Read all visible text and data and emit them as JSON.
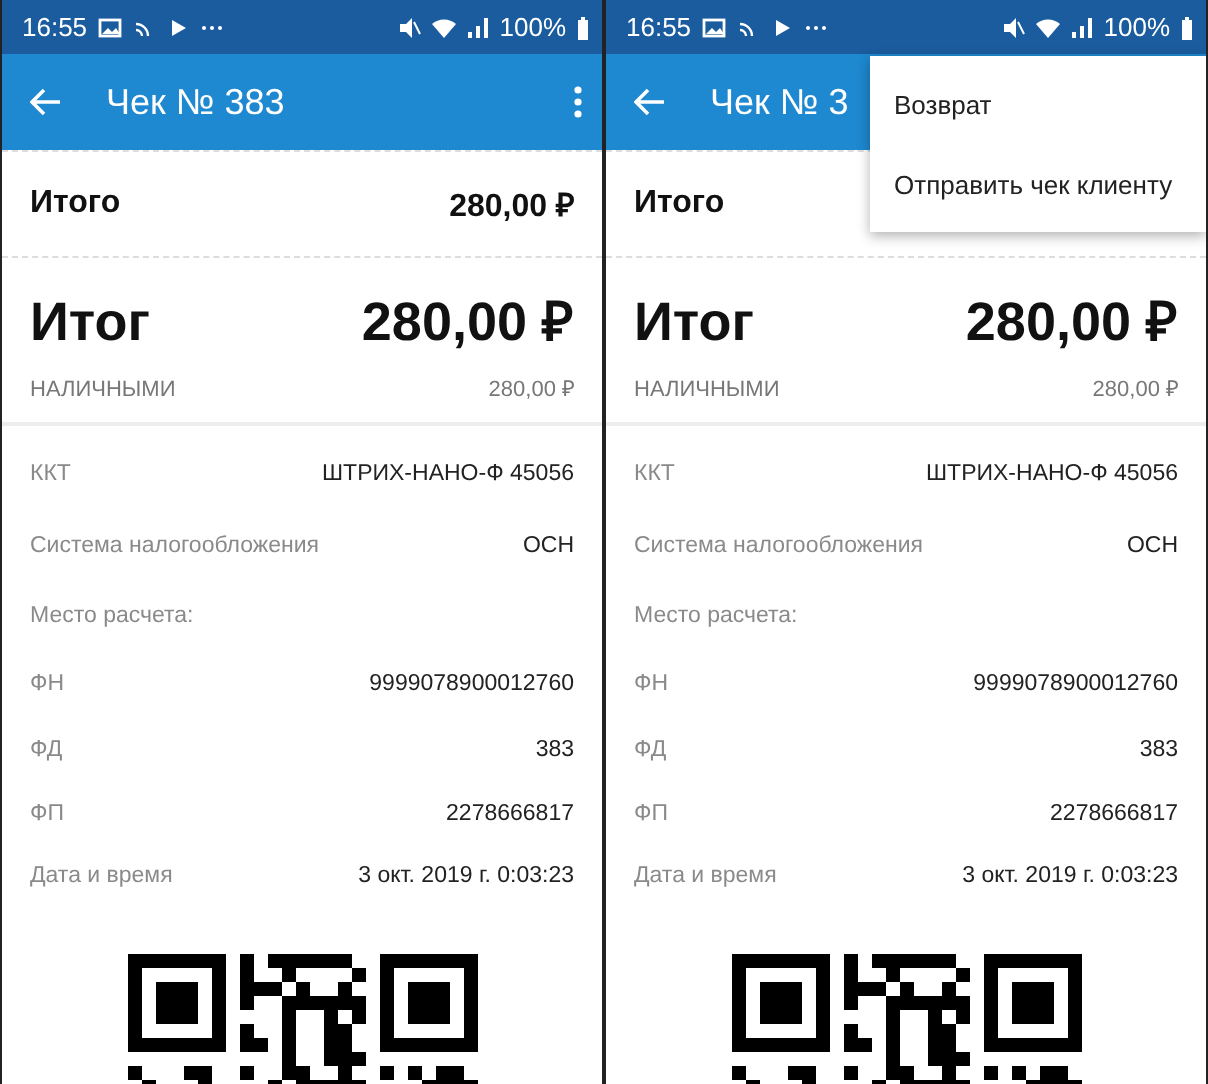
{
  "screens": [
    {
      "status": {
        "time": "16:55",
        "battery": "100%"
      },
      "title": "Чек № 383",
      "menu_button": true,
      "total_row": {
        "label": "Итого",
        "value": "280,00 ₽"
      },
      "grand_total": {
        "label": "Итог",
        "value": "280,00 ₽"
      },
      "payment": {
        "label": "НАЛИЧНЫМИ",
        "value": "280,00 ₽"
      },
      "details": [
        {
          "label": "ККТ",
          "value": "ШТРИХ-НАНО-Ф 45056"
        },
        {
          "label": "Система налогообложения",
          "value": "ОСН"
        },
        {
          "label": "Место расчета:"
        },
        {
          "label": "ФН",
          "value": "9999078900012760"
        },
        {
          "label": "ФД",
          "value": "383"
        },
        {
          "label": "ФП",
          "value": "2278666817"
        },
        {
          "label": "Дата и время",
          "value": "3 окт. 2019 г. 0:03:23"
        }
      ]
    },
    {
      "status": {
        "time": "16:55",
        "battery": "100%"
      },
      "title": "Чек № 3",
      "menu_button": false,
      "total_row": {
        "label": "Итого"
      },
      "grand_total": {
        "label": "Итог",
        "value": "280,00 ₽"
      },
      "payment": {
        "label": "НАЛИЧНЫМИ",
        "value": "280,00 ₽"
      },
      "details": [
        {
          "label": "ККТ",
          "value": "ШТРИХ-НАНО-Ф 45056"
        },
        {
          "label": "Система налогообложения",
          "value": "ОСН"
        },
        {
          "label": "Место расчета:"
        },
        {
          "label": "ФН",
          "value": "9999078900012760"
        },
        {
          "label": "ФД",
          "value": "383"
        },
        {
          "label": "ФП",
          "value": "2278666817"
        },
        {
          "label": "Дата и время",
          "value": "3 окт. 2019 г. 0:03:23"
        }
      ],
      "menu": [
        "Возврат",
        "Отправить чек клиенту"
      ]
    }
  ]
}
